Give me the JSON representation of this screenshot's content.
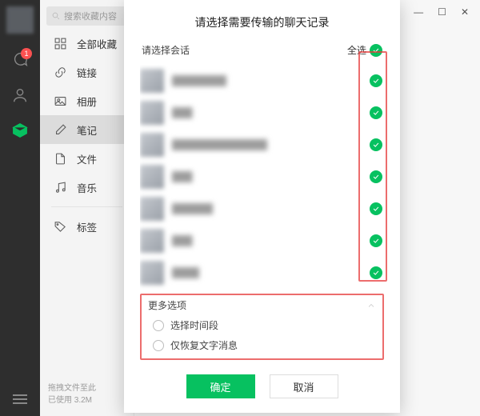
{
  "rail": {
    "badge": "1"
  },
  "search": {
    "placeholder": "搜索收藏内容"
  },
  "nav": {
    "items": [
      {
        "label": "全部收藏"
      },
      {
        "label": "链接"
      },
      {
        "label": "相册"
      },
      {
        "label": "笔记"
      },
      {
        "label": "文件"
      },
      {
        "label": "音乐"
      },
      {
        "label": "标签"
      }
    ]
  },
  "favfoot": {
    "line1": "拖拽文件至此",
    "line2": "已使用 3.2M"
  },
  "dialog": {
    "title": "请选择需要传输的聊天记录",
    "select_label": "请选择会话",
    "select_all": "全选",
    "more_label": "更多选项",
    "opt_time": "选择时间段",
    "opt_textonly": "仅恢复文字消息",
    "ok": "确定",
    "cancel": "取消"
  },
  "chats": [
    {
      "name": "████████"
    },
    {
      "name": "███"
    },
    {
      "name": "██████████████"
    },
    {
      "name": "███"
    },
    {
      "name": "██████"
    },
    {
      "name": "███"
    },
    {
      "name": "████"
    }
  ]
}
